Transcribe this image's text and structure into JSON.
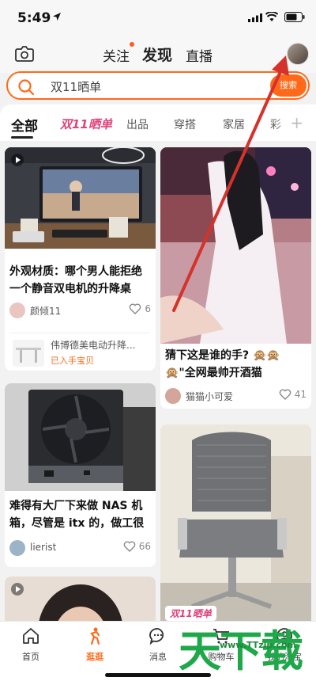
{
  "status": {
    "time": "5:49"
  },
  "nav": {
    "tabs": [
      "关注",
      "发现",
      "直播"
    ],
    "active": "发现"
  },
  "search": {
    "query": "双11晒单",
    "button": "搜索"
  },
  "categories": {
    "all": "全部",
    "special": "双11晒单",
    "items": [
      "出品",
      "穿搭",
      "家居",
      "彩"
    ]
  },
  "cards": [
    {
      "title": "外观材质：哪个男人能拒绝一个静音双电机的升降桌",
      "user": "颜倾11",
      "likes": "6",
      "product_name": "伟博德美电动升降...",
      "product_sub": "已入手宝贝"
    },
    {
      "title": "难得有大厂下来做 NAS 机箱，尽管是 itx 的，做工很",
      "user": "lierist",
      "likes": "66"
    },
    {
      "title": "猜下这是谁的手? 🙊🙊🙊\"全网最帅开酒猫",
      "user": "猫猫小可爱",
      "likes": "41"
    },
    {
      "tag": "双11晒单"
    }
  ],
  "tabbar": [
    {
      "label": "首页",
      "icon": "home-icon"
    },
    {
      "label": "逛逛",
      "icon": "stroll-icon"
    },
    {
      "label": "消息",
      "icon": "message-icon"
    },
    {
      "label": "购物车",
      "icon": "cart-icon"
    },
    {
      "label": "我的淘宝",
      "icon": "profile-icon"
    }
  ],
  "watermark": {
    "big": "天下载",
    "url": "www.TTzip.com"
  },
  "colors": {
    "accent": "#ff6a1a",
    "special": "#e0437a",
    "arrow": "#d4322a"
  }
}
